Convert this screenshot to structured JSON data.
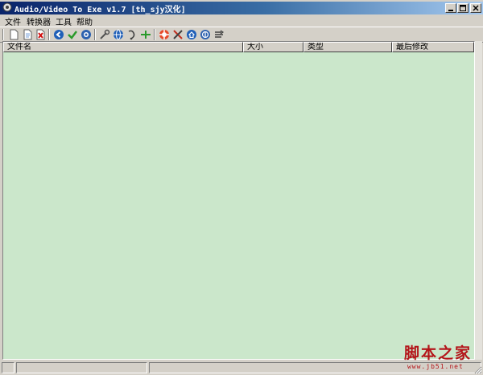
{
  "window": {
    "title": "Audio/Video To Exe v1.7 [th_sjy汉化]",
    "controls": [
      "minimize",
      "maximize",
      "close"
    ]
  },
  "menu": {
    "items": [
      "文件",
      "转换器",
      "工具",
      "帮助"
    ]
  },
  "toolbar": {
    "icons": [
      "new-icon",
      "open-icon",
      "delete-icon",
      "back-icon",
      "check-icon",
      "options-icon",
      "tools-icon",
      "globe-icon",
      "info-icon",
      "add-icon",
      "help-icon",
      "settings-icon",
      "home-icon",
      "web-icon",
      "exit-icon"
    ]
  },
  "list": {
    "columns": [
      "文件名",
      "大小",
      "类型",
      "最后修改"
    ],
    "rows": []
  },
  "watermark": {
    "main": "脚本之家",
    "sub": "www.jb51.net"
  },
  "colors": {
    "list_background": "#cbe7cb",
    "title_gradient_start": "#0a246a",
    "title_gradient_end": "#a6caf0",
    "watermark": "#b4151a"
  }
}
